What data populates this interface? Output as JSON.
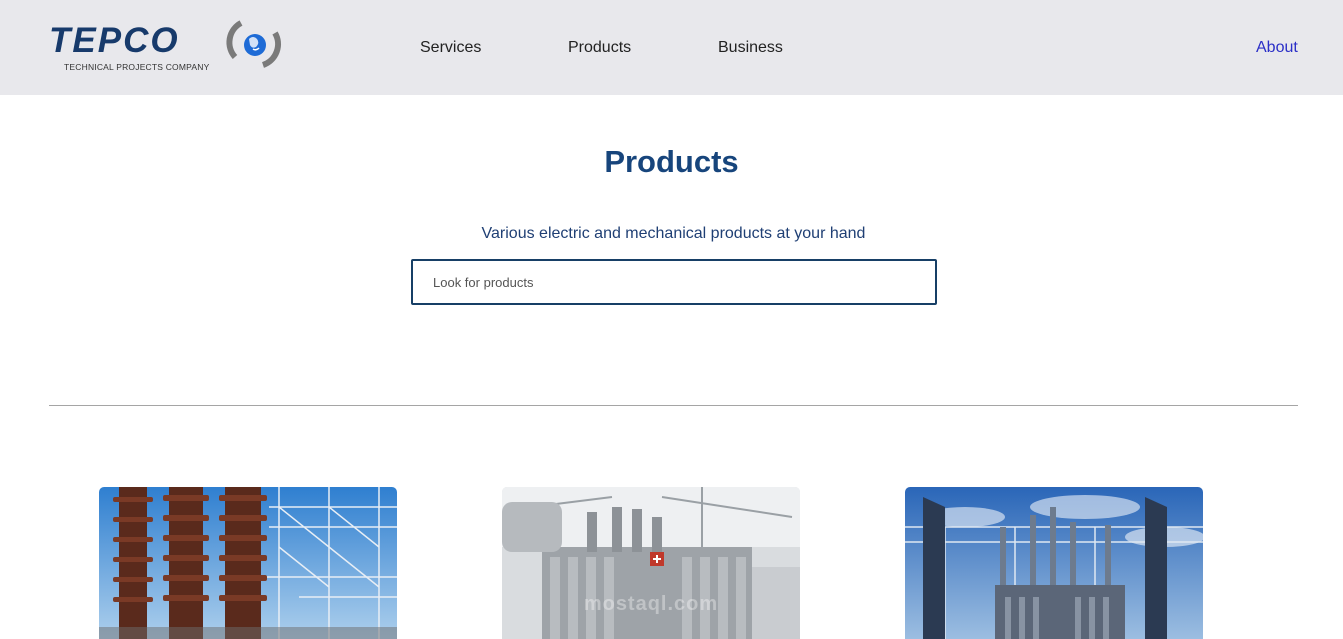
{
  "brand": {
    "name": "TEPCO",
    "tagline": "TECHNICAL PROJECTS COMPANY",
    "primary_color": "#173a6b",
    "accent_color": "#1e6bd6"
  },
  "nav": {
    "services": "Services",
    "products": "Products",
    "business": "Business",
    "about": "About"
  },
  "main": {
    "title": "Products",
    "subtitle": "Various electric and mechanical products at your hand",
    "search_placeholder": "Look for products"
  },
  "products": [
    {
      "image": "high-voltage-bushings-photo"
    },
    {
      "image": "power-transformer-photo",
      "watermark": "mostaql.com"
    },
    {
      "image": "electrical-substation-photo"
    }
  ]
}
